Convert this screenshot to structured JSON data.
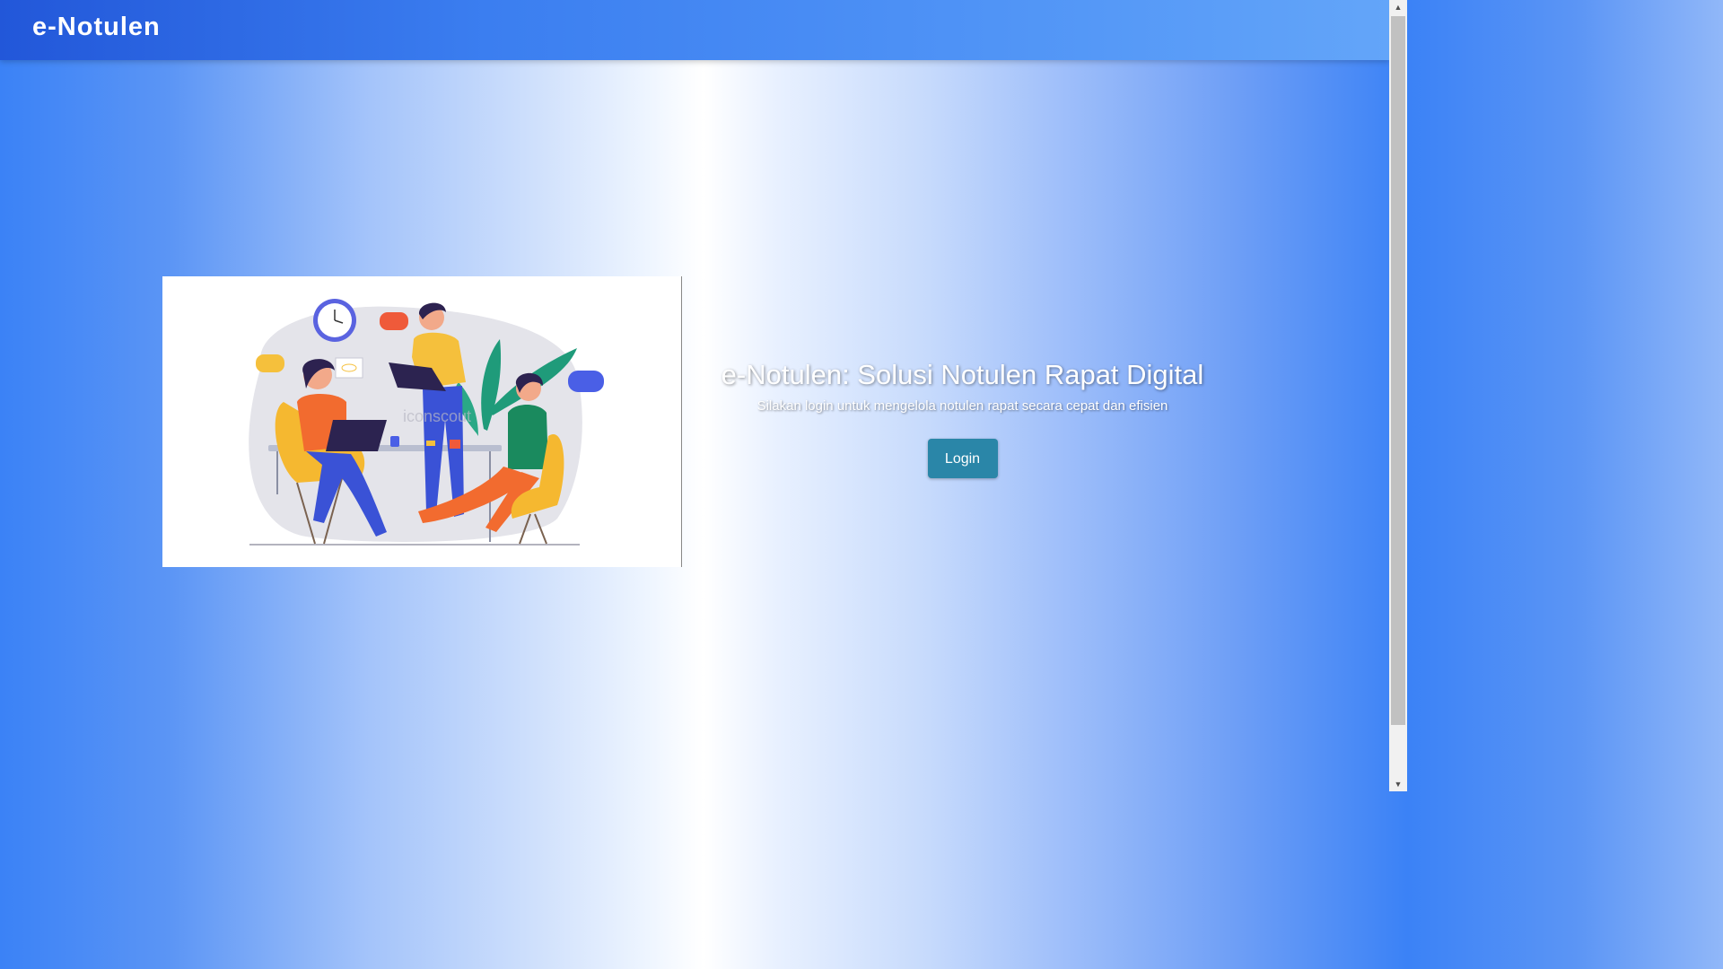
{
  "navbar": {
    "brand": "e-Notulen"
  },
  "hero": {
    "title": "e-Notulen: Solusi Notulen Rapat Digital",
    "subtitle": "Silakan login untuk mengelola notulen rapat secara cepat dan efisien",
    "login_label": "Login"
  },
  "illustration": {
    "watermark": "iconscout"
  },
  "colors": {
    "accent": "#2a86a8",
    "navbar_start": "#2257d9",
    "navbar_end": "#63a5f9"
  }
}
